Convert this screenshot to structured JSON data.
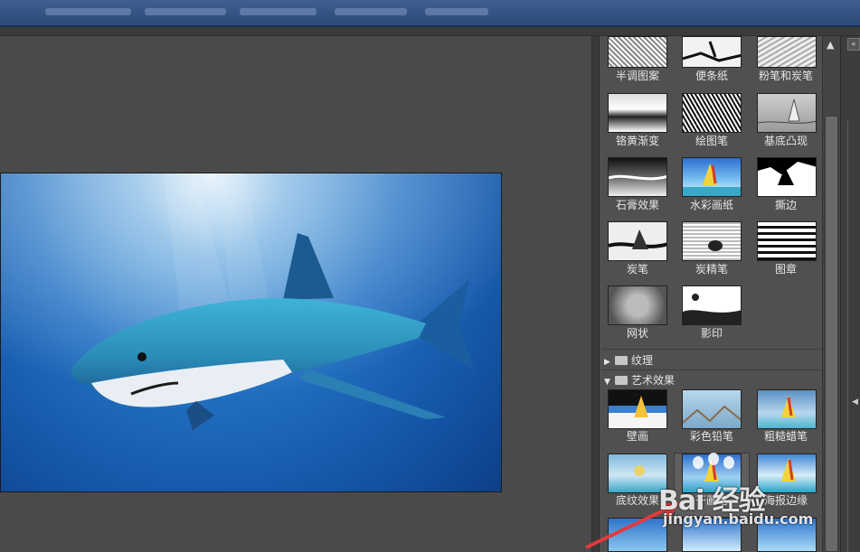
{
  "panel": {
    "thumbnails": [
      {
        "label": "半调图案",
        "preview": "halftone"
      },
      {
        "label": "便条纸",
        "preview": "note-paper"
      },
      {
        "label": "粉笔和炭笔",
        "preview": "chalk"
      },
      {
        "label": "铬黄渐变",
        "preview": "chrome"
      },
      {
        "label": "绘图笔",
        "preview": "pen"
      },
      {
        "label": "基底凸现",
        "preview": "relief"
      },
      {
        "label": "石膏效果",
        "preview": "plaster"
      },
      {
        "label": "水彩画纸",
        "preview": "watercolor-paper"
      },
      {
        "label": "撕边",
        "preview": "torn-edges"
      },
      {
        "label": "炭笔",
        "preview": "charcoal"
      },
      {
        "label": "炭精笔",
        "preview": "conte"
      },
      {
        "label": "图章",
        "preview": "stamp"
      },
      {
        "label": "网状",
        "preview": "reticulation"
      },
      {
        "label": "影印",
        "preview": "photocopy"
      }
    ],
    "categories": [
      {
        "label": "纹理",
        "expanded": false
      },
      {
        "label": "艺术效果",
        "expanded": true
      }
    ],
    "art_thumbnails": [
      {
        "label": "壁画",
        "preview": "fresco"
      },
      {
        "label": "彩色铅笔",
        "preview": "colored-pencil"
      },
      {
        "label": "粗糙蜡笔",
        "preview": "rough-pastels"
      },
      {
        "label": "底纹效果",
        "preview": "underpainting"
      },
      {
        "label": "干画笔",
        "preview": "dry-brush",
        "selected": true
      },
      {
        "label": "海报边缘",
        "preview": "poster-edges"
      }
    ]
  },
  "watermark": {
    "brand": "Bai 经验",
    "url": "jingyan.baidu.com"
  },
  "colors": {
    "accent_arrow": "#e23b3b",
    "panel_bg": "#505050",
    "canvas_bg": "#4a4a4a"
  }
}
